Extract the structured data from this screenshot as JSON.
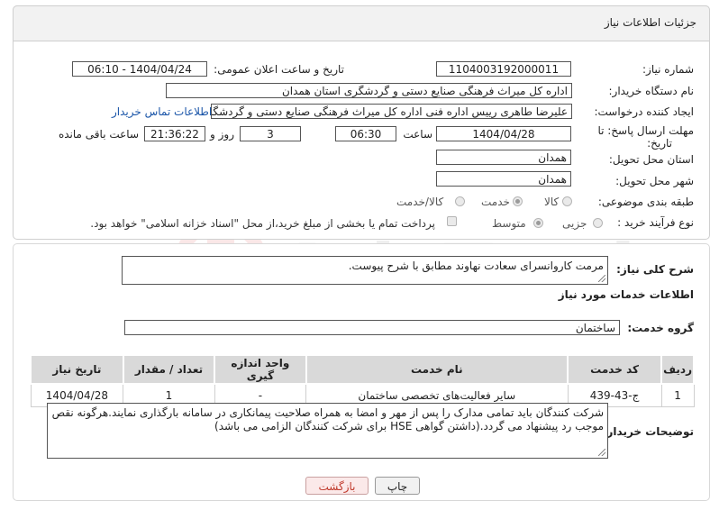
{
  "header": {
    "title": "جزئیات اطلاعات نیاز"
  },
  "form": {
    "need_number": {
      "label": "شماره نیاز:",
      "value": "1104003192000011"
    },
    "announce_datetime": {
      "label": "تاریخ و ساعت اعلان عمومی:",
      "value": "1404/04/24 - 06:10"
    },
    "buyer_org": {
      "label": "نام دستگاه خریدار:",
      "value": "اداره کل میراث فرهنگی  صنایع دستی و گردشگری استان همدان"
    },
    "requester": {
      "label": "ایجاد کننده درخواست:",
      "value": "علیرضا طاهری رییس اداره فنی اداره کل میراث فرهنگی  صنایع دستی و گردشگری",
      "contact_link": "اطلاعات تماس خریدار"
    },
    "deadline": {
      "label_line1": "مهلت ارسال پاسخ: تا",
      "label_line2": "تاریخ:",
      "date": "1404/04/28",
      "time_label": "ساعت",
      "time": "06:30",
      "days": "3",
      "days_label": "روز و",
      "remaining": "21:36:22",
      "remaining_label": "ساعت باقی مانده"
    },
    "delivery_province": {
      "label": "استان محل تحویل:",
      "value": "همدان"
    },
    "delivery_city": {
      "label": "شهر محل تحویل:",
      "value": "همدان"
    },
    "category": {
      "label": "طبقه بندی موضوعی:",
      "options": [
        "کالا",
        "خدمت",
        "کالا/خدمت"
      ],
      "selected": "خدمت"
    },
    "purchase_type": {
      "label": "نوع فرآیند خرید :",
      "options": [
        "جزیی",
        "متوسط"
      ],
      "selected": "متوسط",
      "payment_note": "پرداخت تمام یا بخشی از مبلغ خرید،از محل \"اسناد خزانه اسلامی\" خواهد بود."
    }
  },
  "summary": {
    "label": "شرح کلی نیاز:",
    "value": "مرمت کاروانسرای سعادت نهاوند مطابق  با شرح پیوست."
  },
  "services": {
    "section_title": "اطلاعات خدمات مورد نیاز",
    "group_label": "گروه خدمت:",
    "group_value": "ساختمان",
    "columns": [
      "ردیف",
      "کد خدمت",
      "نام خدمت",
      "واحد اندازه گیری",
      "تعداد / مقدار",
      "تاریخ نیاز"
    ],
    "rows": [
      {
        "row": "1",
        "code": "ج-43-439",
        "name": "سایر فعالیت‌های تخصصی ساختمان",
        "unit": "-",
        "qty": "1",
        "date": "1404/04/28"
      }
    ]
  },
  "buyer_notes": {
    "label": "توضیحات خریدار:",
    "value": "شرکت کنندگان باید تمامی مدارک را پس از مهر و امضا به همراه صلاحیت پیمانکاری در سامانه بارگذاری نمایند.هرگونه نقص موجب رد پیشنهاد می گردد.(داشتن گواهی HSE برای شرکت کنندگان الزامی می باشد)"
  },
  "buttons": {
    "print": "چاپ",
    "back": "بازگشت"
  },
  "watermark": {
    "text": "AriaTender.neT"
  },
  "colors": {
    "link": "#1a55a8",
    "back_button_text": "#c0392b",
    "back_button_bg": "#fbe9e9"
  }
}
